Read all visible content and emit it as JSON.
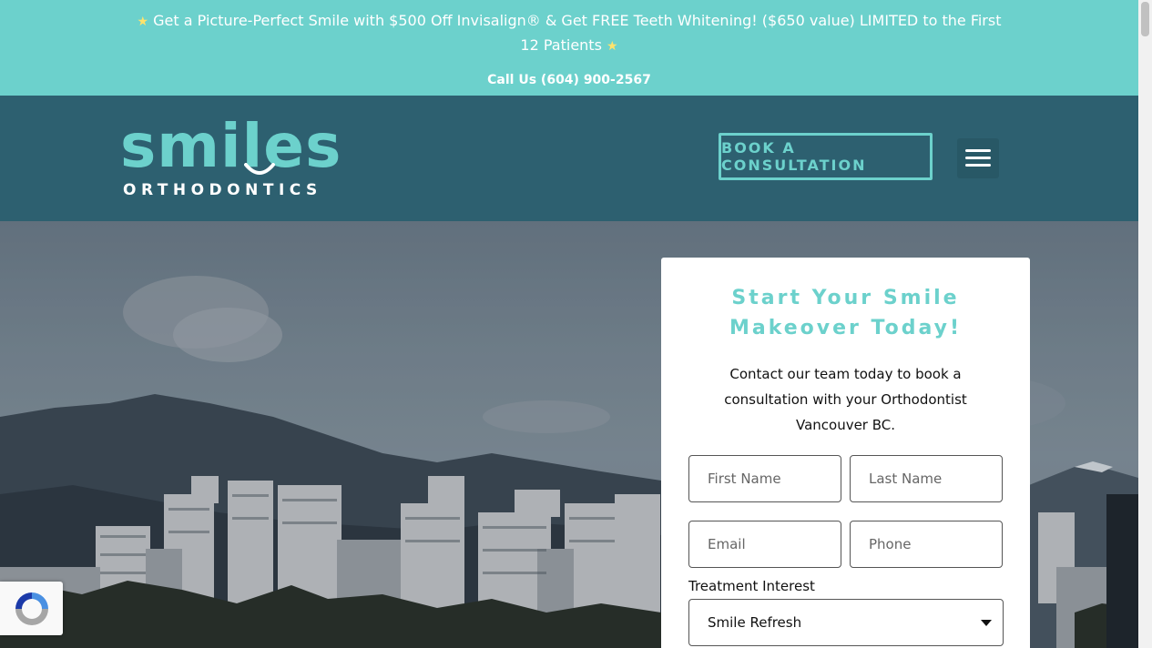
{
  "announcement": {
    "promo_text": "Get a Picture-Perfect Smile with $500 Off Invisalign® & Get FREE Teeth Whitening! ($650 value) LIMITED to the First 12 Patients",
    "star_icon": "star-icon",
    "phone_text": "Call Us (604) 900-2567",
    "background": "#6cd1cc"
  },
  "header": {
    "logo_word": "smiles",
    "logo_subtitle": "ORTHODONTICS",
    "book_button": "BOOK A CONSULTATION",
    "menu_icon": "hamburger-menu-icon",
    "background": "#2d6070",
    "accent": "#6cd1cc"
  },
  "form": {
    "title": "Start Your Smile Makeover Today!",
    "description": "Contact our team today to book a consultation with your Orthodontist Vancouver BC.",
    "first_name_placeholder": "First Name",
    "last_name_placeholder": "Last Name",
    "email_placeholder": "Email",
    "phone_placeholder": "Phone",
    "treatment_label": "Treatment Interest",
    "treatment_selected": "Smile Refresh"
  },
  "recaptcha": {
    "icon": "recaptcha-icon"
  }
}
